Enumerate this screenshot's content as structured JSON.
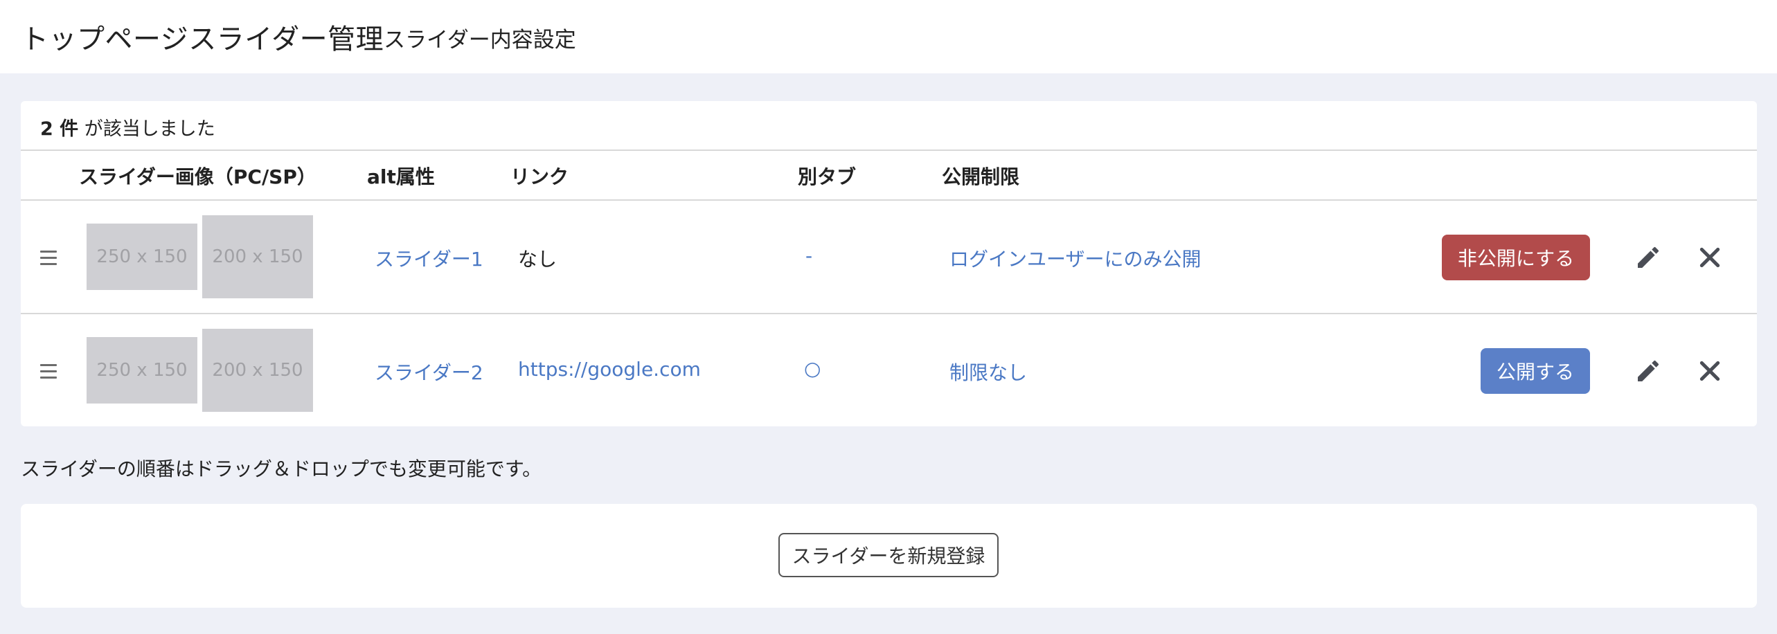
{
  "header": {
    "title": "トップページスライダー管理",
    "subtitle": "スライダー内容設定"
  },
  "results": {
    "count": "2 件",
    "suffix": "が該当しました"
  },
  "table": {
    "columns": {
      "image": "スライダー画像（PC/SP）",
      "alt": "alt属性",
      "link": "リンク",
      "new_tab": "別タブ",
      "visibility": "公開制限"
    },
    "rows": [
      {
        "pc_image": "250 x 150",
        "sp_image": "200 x 150",
        "alt": "スライダー1",
        "link": "なし",
        "new_tab": "-",
        "visibility": "ログインユーザーにのみ公開",
        "toggle_label": "非公開にする"
      },
      {
        "pc_image": "250 x 150",
        "sp_image": "200 x 150",
        "alt": "スライダー2",
        "link": "https://google.com",
        "new_tab": "○",
        "visibility": "制限なし",
        "toggle_label": "公開する"
      }
    ]
  },
  "note": "スライダーの順番はドラッグ＆ドロップでも変更可能です。",
  "new_button": "スライダーを新規登録",
  "icons": {
    "drag": "drag-handle-icon",
    "edit": "pencil-icon",
    "delete": "close-icon"
  },
  "colors": {
    "link": "#4a78c4",
    "unpublish_button": "#b24b4b",
    "publish_button": "#5b80c8",
    "background": "#eef0f7"
  }
}
